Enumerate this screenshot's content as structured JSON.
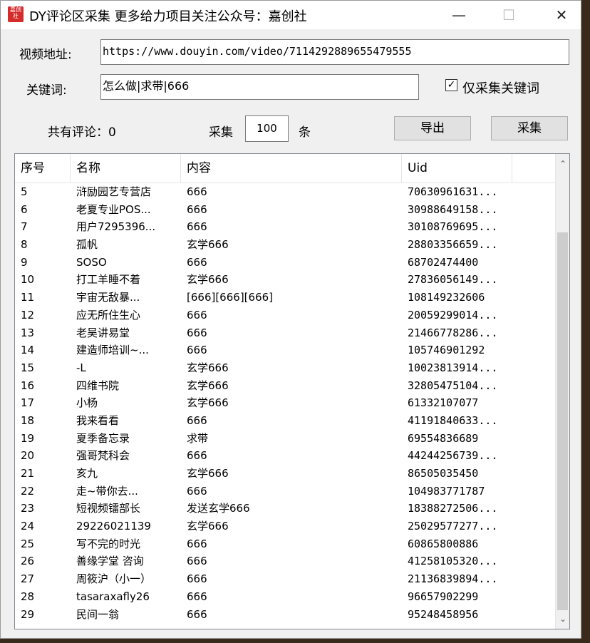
{
  "window": {
    "icon_text": "嘉创社",
    "title": "DY评论区采集  更多给力项目关注公众号：嘉创社",
    "min_glyph": "—",
    "max_glyph": "☐",
    "close_glyph": "✕"
  },
  "form": {
    "video_label": "视频地址:",
    "video_value": "https://www.douyin.com/video/7114292889655479555",
    "keyword_label": "关键词:",
    "keyword_value": "怎么做|求带|666",
    "only_keyword_label": "仅采集关键词",
    "only_keyword_checked": true,
    "total_label": "共有评论：0",
    "collect_prefix": "采集",
    "collect_count": "100",
    "collect_suffix": "条",
    "export_button": "导出",
    "collect_button": "采集"
  },
  "table": {
    "columns": [
      "序号",
      "名称",
      "内容",
      "Uid"
    ],
    "rows": [
      [
        "5",
        "浒励园艺专营店",
        "666",
        "70630961631..."
      ],
      [
        "6",
        "老夏专业POS...",
        "666",
        "30988649158..."
      ],
      [
        "7",
        "用户7295396...",
        "666",
        "30108769695..."
      ],
      [
        "8",
        "孤帆",
        "玄学666",
        "28803356659..."
      ],
      [
        "9",
        "SOSO",
        "666",
        "68702474400"
      ],
      [
        "10",
        "打工羊睡不着",
        "玄学666",
        "27836056149..."
      ],
      [
        "11",
        "宇宙无敌暴...",
        "[666][666][666]",
        "108149232606"
      ],
      [
        "12",
        "应无所住生心",
        "666",
        "20059299014..."
      ],
      [
        "13",
        "老吴讲易堂",
        "666",
        "21466778286..."
      ],
      [
        "14",
        "建造师培训~...",
        "666",
        "105746901292"
      ],
      [
        "15",
        "-L",
        "玄学666",
        "10023813914..."
      ],
      [
        "16",
        "四维书院",
        "玄学666",
        "32805475104..."
      ],
      [
        "17",
        "小杨",
        "玄学666",
        "61332107077"
      ],
      [
        "18",
        "我来看看",
        "666",
        "41191840633..."
      ],
      [
        "19",
        "夏季备忘录",
        "求带",
        "69554836689"
      ],
      [
        "20",
        "强哥梵科会",
        "666",
        "44244256739..."
      ],
      [
        "21",
        "亥九",
        "玄学666",
        "86505035450"
      ],
      [
        "22",
        "走~带你去...",
        "666",
        "104983771787"
      ],
      [
        "23",
        "短视频镭部长",
        "发送玄学666",
        "18388272506..."
      ],
      [
        "24",
        "29226021139",
        "玄学666",
        "25029577277..."
      ],
      [
        "25",
        "写不完的时光",
        "666",
        "60865800886"
      ],
      [
        "26",
        "善缘学堂 咨询",
        "666",
        "41258105320..."
      ],
      [
        "27",
        "周筱沪（小一）",
        "666",
        "21136839894..."
      ],
      [
        "28",
        "tasaraxafly26",
        "666",
        "96657902299"
      ],
      [
        "29",
        "民间一翁",
        "666",
        "95248458956"
      ]
    ]
  },
  "scrollbar": {
    "up_glyph": "⌃",
    "down_glyph": "⌄"
  }
}
